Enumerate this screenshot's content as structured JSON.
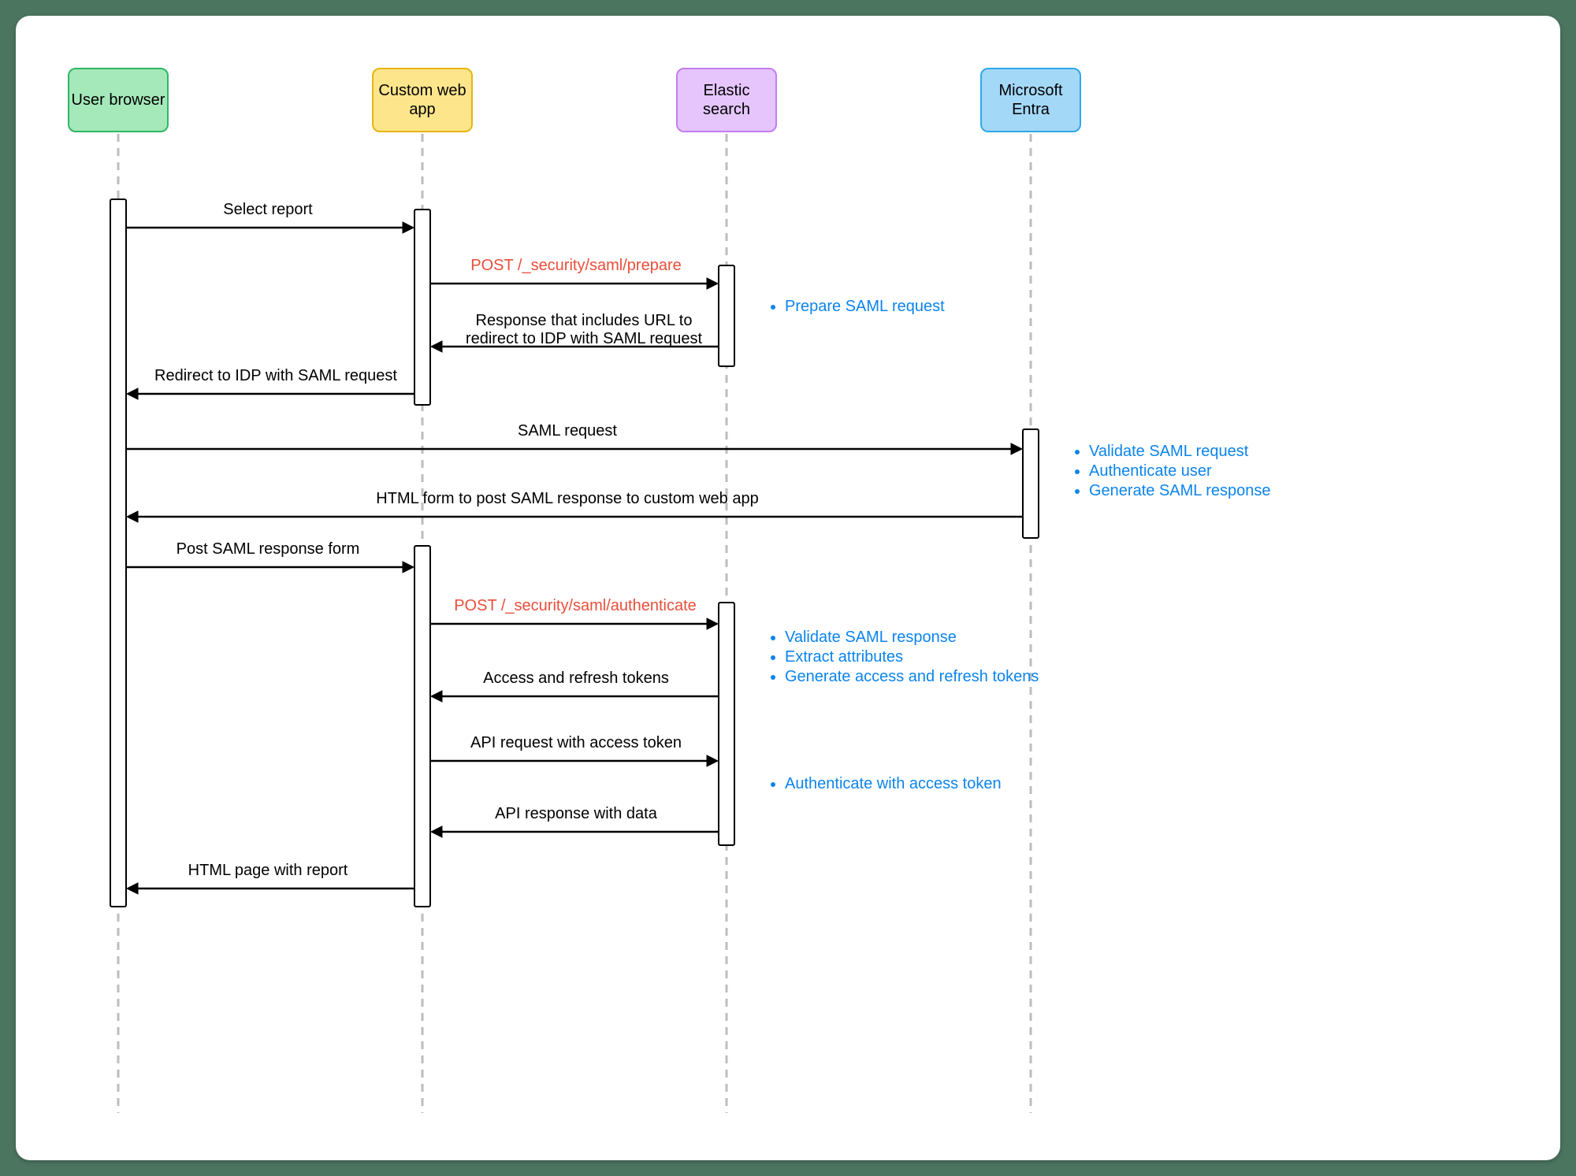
{
  "actors": {
    "browser": "User\nbrowser",
    "app": "Custom\nweb app",
    "elastic": "Elastic\nsearch",
    "entra": "Microsoft\nEntra"
  },
  "messages": {
    "m1": "Select report",
    "m2": "POST /_security/saml/prepare",
    "m3": "Response that includes URL to\nredirect to IDP with SAML request",
    "m4": "Redirect to IDP with SAML request",
    "m5": "SAML request",
    "m6": "HTML form to post SAML response to custom web app",
    "m7": "Post SAML response form",
    "m8": "POST /_security/saml/authenticate",
    "m9": "Access and refresh tokens",
    "m10": "API request with access token",
    "m11": "API response with data",
    "m12": "HTML page with report"
  },
  "notes": {
    "n1": [
      "Prepare SAML request"
    ],
    "n2": [
      "Validate SAML request",
      "Authenticate user",
      "Generate SAML response"
    ],
    "n3": [
      "Validate SAML response",
      "Extract attributes",
      "Generate access and refresh tokens"
    ],
    "n4": [
      "Authenticate with access token"
    ]
  },
  "colors": {
    "accent_blue": "#0b84ec",
    "accent_red": "#e94e3a"
  }
}
